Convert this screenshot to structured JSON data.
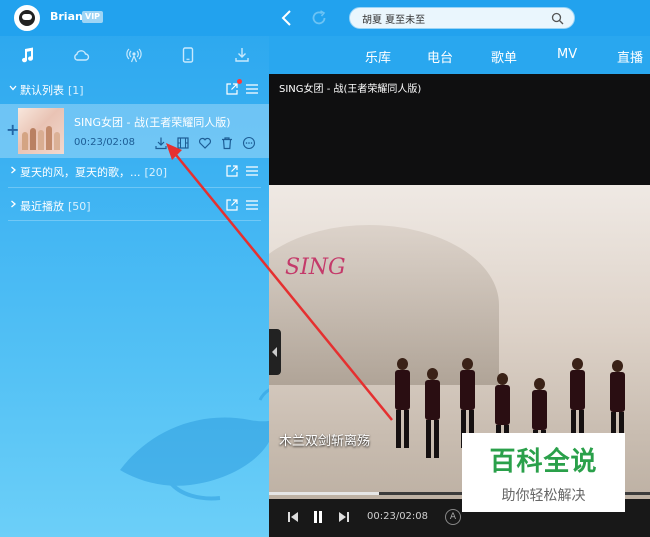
{
  "user": {
    "name": "Brian",
    "badge": "VIP"
  },
  "sidebar_tabs": [
    "music-note-icon",
    "cloud-icon",
    "radio-icon",
    "device-icon",
    "download-icon"
  ],
  "playlists": [
    {
      "name": "默认列表",
      "count": "[1]"
    },
    {
      "name": "夏天的风，夏天的歌，...",
      "count": "[20]"
    },
    {
      "name": "最近播放",
      "count": "[50]"
    }
  ],
  "song": {
    "title": "SING女团 - 战(王者荣耀同人版)",
    "time": "00:23/02:08"
  },
  "search": {
    "value": "胡夏 夏至未至"
  },
  "nav": [
    "乐库",
    "电台",
    "歌单",
    "MV",
    "直播"
  ],
  "player": {
    "title": "SING女团 - 战(王者荣耀同人版)",
    "logo": "SING",
    "lyric": "木兰双剑斩离殇",
    "time": "00:23/02:08",
    "lyric_toggle": "A",
    "progress": 0.29
  },
  "watermark": {
    "line1": "百科全说",
    "line2": "助你轻松解决"
  },
  "colors": {
    "accent": "#29a3ec",
    "annotation": "#e53030",
    "watermark_green": "#2aa04a"
  }
}
